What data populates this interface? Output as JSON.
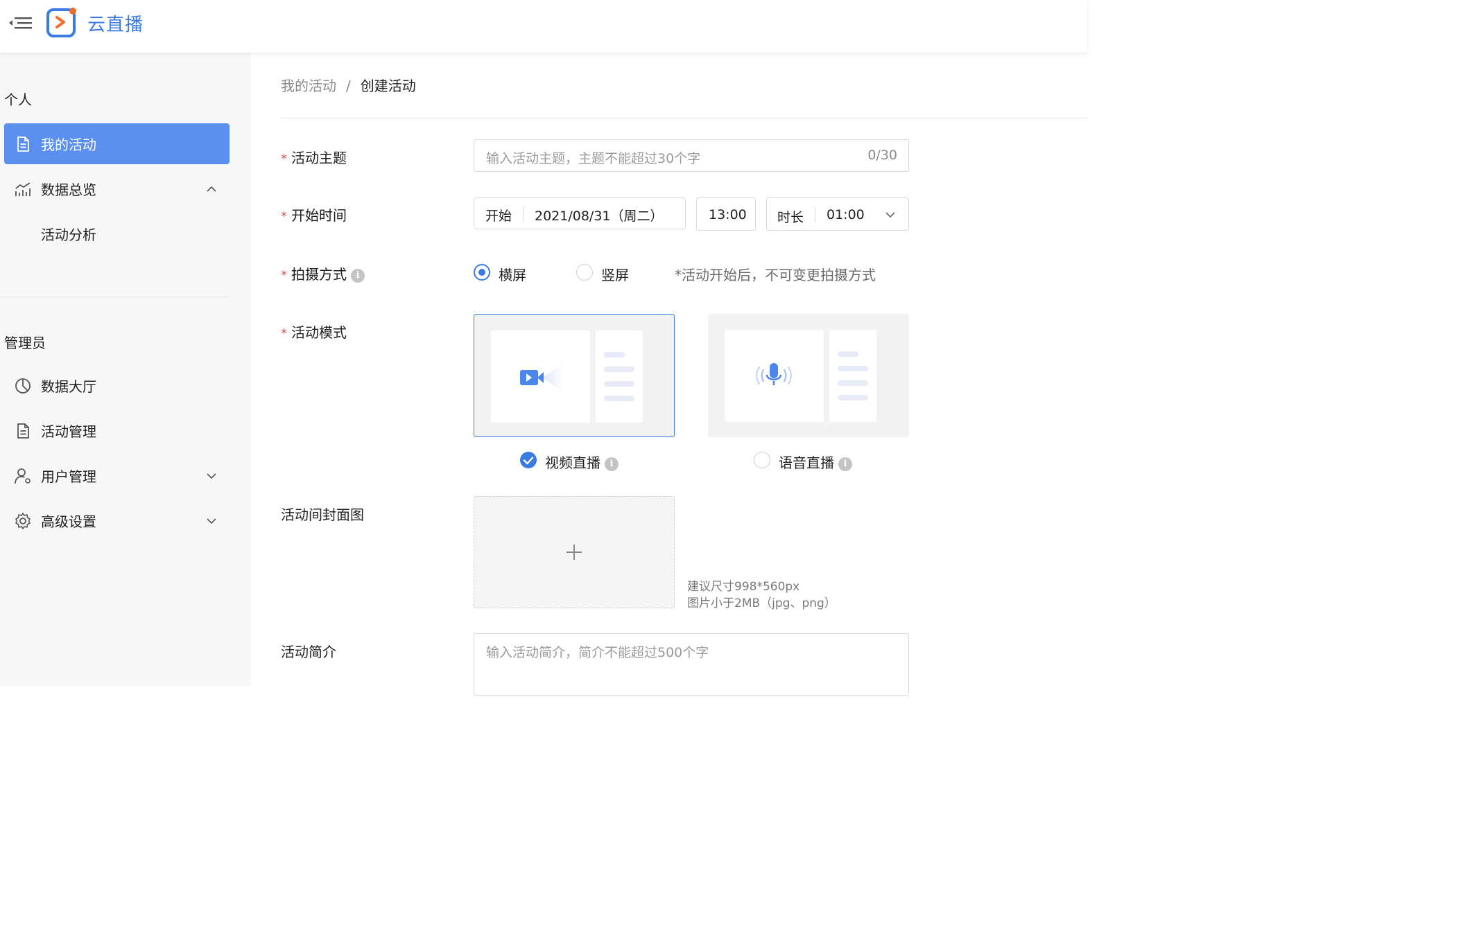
{
  "header": {
    "brand": "云直播",
    "accent_color": "#3a7be3",
    "icons": [
      "menu-collapse-icon",
      "app-logo-icon"
    ]
  },
  "sidebar": {
    "personal_title": "个人",
    "personal_items": [
      {
        "label": "我的活动",
        "icon": "document-icon",
        "active": true
      },
      {
        "label": "数据总览",
        "icon": "chart-icon",
        "expanded": true
      },
      {
        "label": "活动分析",
        "sub": true
      }
    ],
    "admin_title": "管理员",
    "admin_items": [
      {
        "label": "数据大厅",
        "icon": "pie-chart-icon"
      },
      {
        "label": "活动管理",
        "icon": "document-icon"
      },
      {
        "label": "用户管理",
        "icon": "user-settings-icon",
        "expanded": false
      },
      {
        "label": "高级设置",
        "icon": "gear-icon",
        "expanded": false
      }
    ]
  },
  "breadcrumb": {
    "prev": "我的活动",
    "separator": "/",
    "current": "创建活动"
  },
  "form": {
    "required_mark": "*",
    "topic": {
      "label": "活动主题",
      "placeholder": "输入活动主题，主题不能超过30个字",
      "counter": "0/30"
    },
    "start_time": {
      "label": "开始时间",
      "start_prefix": "开始",
      "date": "2021/08/31（周二）",
      "time": "13:00",
      "duration_prefix": "时长",
      "duration": "01:00"
    },
    "shooting": {
      "label": "拍摄方式",
      "options": [
        {
          "label": "横屏",
          "checked": true
        },
        {
          "label": "竖屏",
          "checked": false
        }
      ],
      "hint": "*活动开始后，不可变更拍摄方式"
    },
    "mode": {
      "label": "活动模式",
      "options": [
        {
          "label": "视频直播",
          "checked": true,
          "icon": "video-camera-icon"
        },
        {
          "label": "语音直播",
          "checked": false,
          "icon": "microphone-icon"
        }
      ]
    },
    "cover": {
      "label": "活动间封面图",
      "hint_size": "建议尺寸998*560px",
      "hint_format": "图片小于2MB（jpg、png）"
    },
    "intro": {
      "label": "活动简介",
      "placeholder": "输入活动简介，简介不能超过500个字"
    }
  }
}
